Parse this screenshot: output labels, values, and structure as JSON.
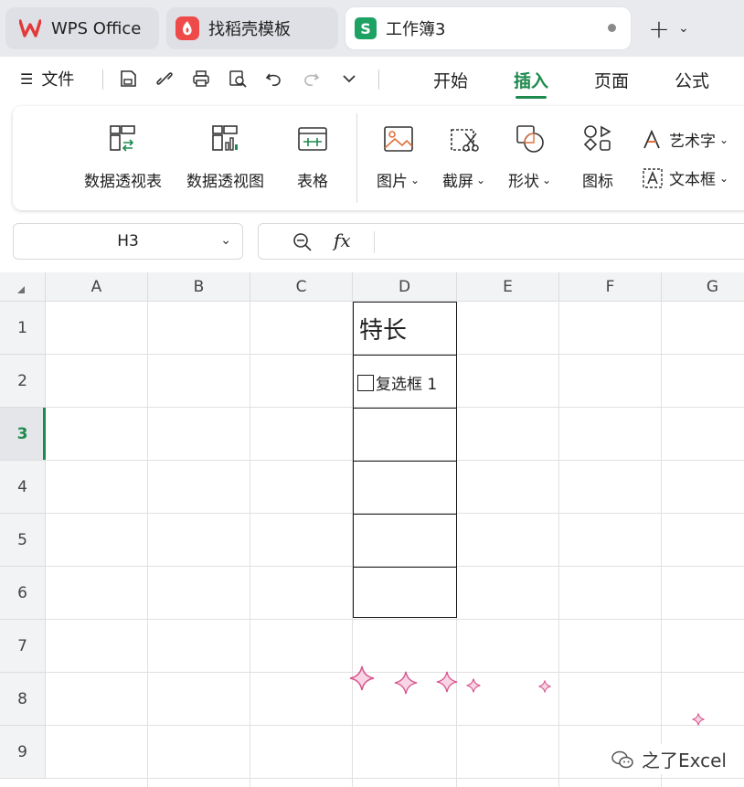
{
  "tabs": {
    "wps": "WPS Office",
    "daoke": "找稻壳模板",
    "book": "工作簿3"
  },
  "menu": {
    "file": "文件",
    "ribbon_tabs": [
      "开始",
      "插入",
      "页面",
      "公式"
    ],
    "active_tab": "插入"
  },
  "ribbon": {
    "pivot_table": "数据透视表",
    "pivot_chart": "数据透视图",
    "table": "表格",
    "picture": "图片",
    "screenshot": "截屏",
    "shape": "形状",
    "icon": "图标",
    "wordart": "艺术字",
    "textbox": "文本框"
  },
  "formula_bar": {
    "name_box": "H3",
    "fx": "fx",
    "value": ""
  },
  "grid": {
    "columns": [
      "A",
      "B",
      "C",
      "D",
      "E",
      "F",
      "G"
    ],
    "rows": [
      "1",
      "2",
      "3",
      "4",
      "5",
      "6",
      "7",
      "8",
      "9"
    ],
    "selected_row": "3",
    "cells": {
      "D1": "特长",
      "D2_checkbox_label": "复选框 1"
    }
  },
  "watermark": "之了Excel",
  "colors": {
    "accent": "#1e8a4e",
    "wps_red": "#e03a3a",
    "sparkle_pink": "#d8558e"
  }
}
